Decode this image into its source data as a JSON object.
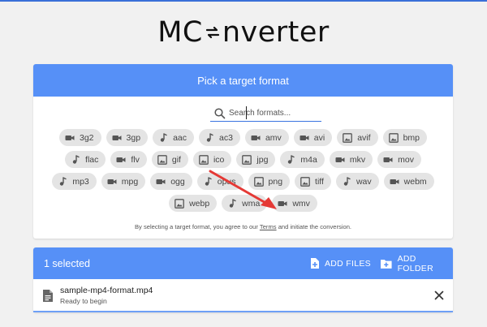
{
  "logo": {
    "prefix": "MC",
    "suffix": "nverter"
  },
  "picker": {
    "title": "Pick a target format",
    "search_placeholder": "Search formats..."
  },
  "formats": [
    {
      "label": "3g2",
      "kind": "video"
    },
    {
      "label": "3gp",
      "kind": "video"
    },
    {
      "label": "aac",
      "kind": "audio"
    },
    {
      "label": "ac3",
      "kind": "audio"
    },
    {
      "label": "amv",
      "kind": "video"
    },
    {
      "label": "avi",
      "kind": "video"
    },
    {
      "label": "avif",
      "kind": "image"
    },
    {
      "label": "bmp",
      "kind": "image"
    },
    {
      "label": "flac",
      "kind": "audio"
    },
    {
      "label": "flv",
      "kind": "video"
    },
    {
      "label": "gif",
      "kind": "image"
    },
    {
      "label": "ico",
      "kind": "image"
    },
    {
      "label": "jpg",
      "kind": "image"
    },
    {
      "label": "m4a",
      "kind": "audio"
    },
    {
      "label": "mkv",
      "kind": "video"
    },
    {
      "label": "mov",
      "kind": "video"
    },
    {
      "label": "mp3",
      "kind": "audio"
    },
    {
      "label": "mpg",
      "kind": "video"
    },
    {
      "label": "ogg",
      "kind": "video"
    },
    {
      "label": "opus",
      "kind": "audio"
    },
    {
      "label": "png",
      "kind": "image"
    },
    {
      "label": "tiff",
      "kind": "image"
    },
    {
      "label": "wav",
      "kind": "audio"
    },
    {
      "label": "webm",
      "kind": "video"
    },
    {
      "label": "webp",
      "kind": "image"
    },
    {
      "label": "wma",
      "kind": "audio"
    },
    {
      "label": "wmv",
      "kind": "video"
    }
  ],
  "terms": {
    "before": "By selecting a target format, you agree to our ",
    "link": "Terms",
    "after": " and initiate the conversion."
  },
  "queue": {
    "selected_label": "1 selected",
    "add_files_label": "ADD FILES",
    "add_folder_label": "ADD FOLDER",
    "files": [
      {
        "name": "sample-mp4-format.mp4",
        "status": "Ready to begin"
      }
    ]
  },
  "colors": {
    "accent": "#5690f7",
    "annotation_arrow": "#e53935"
  }
}
